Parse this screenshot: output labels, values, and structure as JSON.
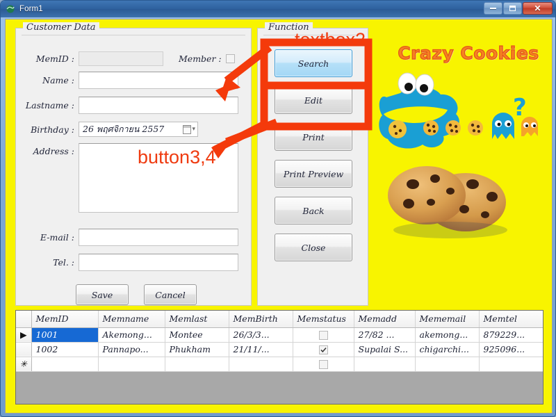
{
  "window": {
    "title": "Form1",
    "icon": "app-icon",
    "buttons": {
      "minimize": "Minimize",
      "maximize": "Maximize",
      "close": "Close"
    }
  },
  "customer_group": {
    "title": "Customer Data",
    "fields": [
      {
        "label": "MemID :",
        "value": "",
        "state": "disabled"
      },
      {
        "label": "Name :",
        "value": "",
        "state": "enabled"
      },
      {
        "label": "Lastname :",
        "value": "",
        "state": "enabled"
      },
      {
        "label": "Birthday :",
        "value": "26 พฤศจิกายน  2557",
        "state": "enabled"
      },
      {
        "label": "Address :",
        "value": "",
        "state": "enabled"
      },
      {
        "label": "E-mail :",
        "value": "",
        "state": "enabled"
      },
      {
        "label": "Tel. :",
        "value": "",
        "state": "enabled"
      }
    ],
    "member_label": "Member :",
    "member_checked": false,
    "save_label": "Save",
    "cancel_label": "Cancel"
  },
  "function_group": {
    "title": "Function",
    "buttons": [
      {
        "label": "Search",
        "state": "highlighted"
      },
      {
        "label": "Edit",
        "state": "normal"
      },
      {
        "label": "Print",
        "state": "normal"
      },
      {
        "label": "Print Preview",
        "state": "normal"
      },
      {
        "label": "Back",
        "state": "normal"
      },
      {
        "label": "Close",
        "state": "normal"
      }
    ]
  },
  "artwork": {
    "logo_text": "Crazy Cookies",
    "logo_color": "#f58220",
    "background_color": "#f8f400",
    "elements": [
      "cookie-monster-icon",
      "cookie-icon",
      "cookie-icon",
      "cookie-icon",
      "blue-ghost-icon",
      "orange-ghost-icon",
      "question-mark-icon",
      "chocolate-chip-cookies-photo"
    ]
  },
  "grid": {
    "columns": [
      "MemID",
      "Memname",
      "Memlast",
      "MemBirth",
      "Memstatus",
      "Memadd",
      "Mememail",
      "Memtel"
    ],
    "rows": [
      {
        "marker": "▶",
        "selected_cell": "MemID",
        "cells": [
          "1001",
          "Akemong...",
          "Montee",
          "26/3/3...",
          "",
          "27/82 ...",
          "akemong...",
          "879229..."
        ],
        "status_checked": false
      },
      {
        "marker": "",
        "selected_cell": "",
        "cells": [
          "1002",
          "Pannapo...",
          "Phukham",
          "21/11/...",
          "",
          "Supalai S...",
          "chigarchi...",
          "925096..."
        ],
        "status_checked": true
      },
      {
        "marker": "✳",
        "selected_cell": "",
        "cells": [
          "",
          "",
          "",
          "",
          "",
          "",
          "",
          ""
        ],
        "status_checked": false
      }
    ]
  },
  "annotations": [
    {
      "text": "textbox2",
      "color": "#ef3b10"
    },
    {
      "text": "button3,4",
      "color": "#ef3b10"
    }
  ]
}
